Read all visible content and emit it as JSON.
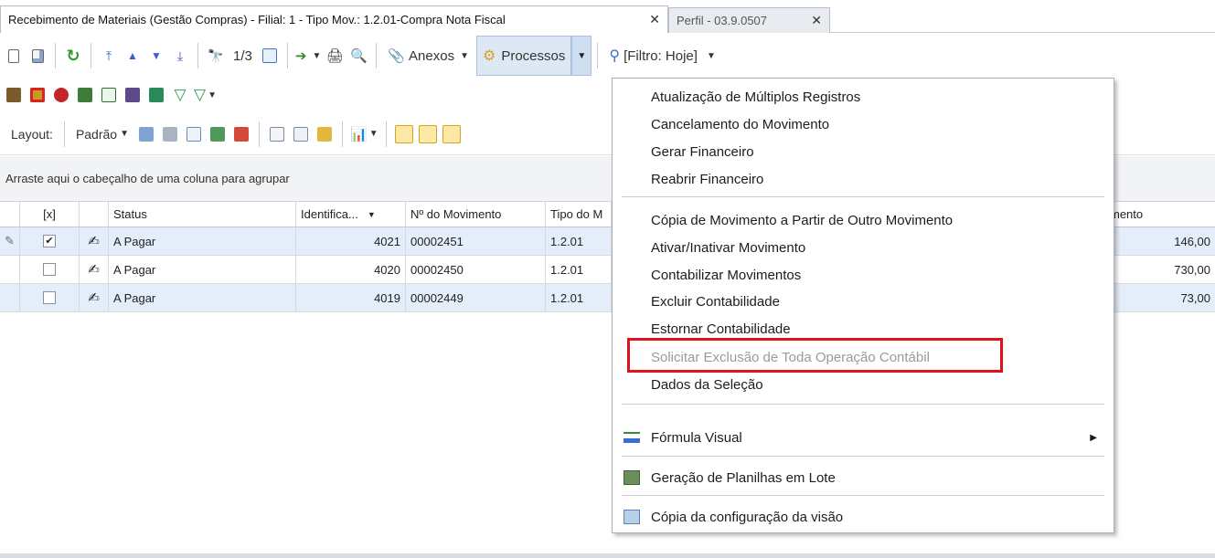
{
  "tabs": [
    {
      "label": "Recebimento de Materiais (Gestão Compras) - Filial: 1 - Tipo Mov.: 1.2.01-Compra Nota Fiscal",
      "close": "✕"
    },
    {
      "label": "Perfil - 03.9.0507",
      "close": "✕"
    }
  ],
  "toolbar": {
    "record_counter": "1/3",
    "anexos": "Anexos",
    "processos": "Processos",
    "filtro": "[Filtro: Hoje]"
  },
  "layout_bar": {
    "layout_label": "Layout:",
    "padrao": "Padrão"
  },
  "group_header": "Arraste aqui o cabeçalho de uma coluna para agrupar",
  "grid": {
    "columns": [
      "[x]",
      "Status",
      "Identifica...",
      "Nº do Movimento",
      "Tipo do M",
      "mento"
    ],
    "rows": [
      {
        "checked": true,
        "status": "A Pagar",
        "id": "4021",
        "movimento": "00002451",
        "tipo": "1.2.01",
        "valor": "146,00"
      },
      {
        "checked": false,
        "status": "A Pagar",
        "id": "4020",
        "movimento": "00002450",
        "tipo": "1.2.01",
        "valor": "730,00"
      },
      {
        "checked": false,
        "status": "A Pagar",
        "id": "4019",
        "movimento": "00002449",
        "tipo": "1.2.01",
        "valor": "73,00"
      }
    ]
  },
  "menu": {
    "items": [
      "Atualização de Múltiplos Registros",
      "Cancelamento do Movimento",
      "Gerar Financeiro",
      "Reabrir Financeiro",
      "Cópia de Movimento a Partir de Outro Movimento",
      "Ativar/Inativar Movimento",
      "Contabilizar Movimentos",
      "Excluir Contabilidade",
      "Estornar Contabilidade",
      "Solicitar Exclusão de Toda Operação Contábil",
      "Dados da Seleção",
      "Fórmula Visual",
      "Geração de Planilhas em Lote",
      "Cópia da configuração da visão"
    ]
  },
  "colors": {
    "selected_row": "#e4eefa",
    "highlight_border": "#e0121b",
    "processos_bg": "#dde8f5"
  }
}
